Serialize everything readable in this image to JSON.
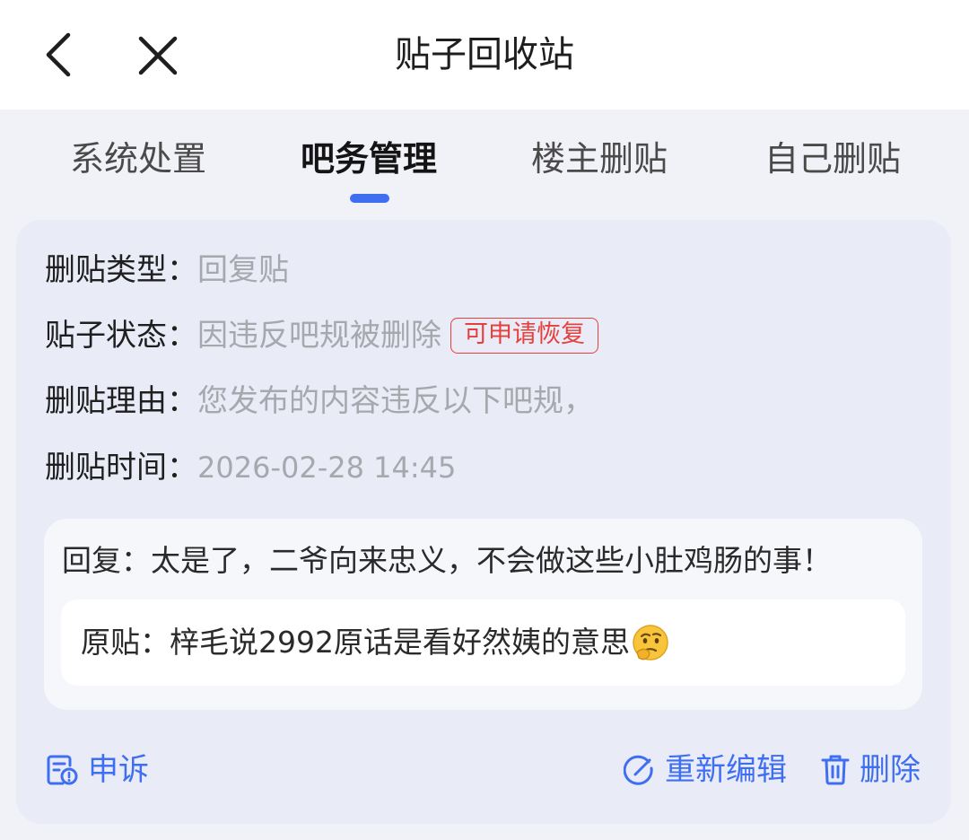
{
  "header": {
    "title": "贴子回收站"
  },
  "tabs": [
    {
      "label": "系统处置",
      "active": false
    },
    {
      "label": "吧务管理",
      "active": true
    },
    {
      "label": "楼主删贴",
      "active": false
    },
    {
      "label": "自己删贴",
      "active": false
    }
  ],
  "post": {
    "type_label": "删贴类型：",
    "type_value": "回复贴",
    "status_label": "贴子状态：",
    "status_value": "因违反吧规被删除",
    "status_badge": "可申请恢复",
    "reason_label": "删贴理由：",
    "reason_value": "您发布的内容违反以下吧规，",
    "time_label": "删贴时间：",
    "time_value": "2026-02-28 14:45",
    "reply_text": "回复：太是了，二爷向来忠义，不会做这些小肚鸡肠的事！",
    "origin_text": "原贴：梓毛说2992原话是看好然姨的意思"
  },
  "actions": {
    "appeal": "申诉",
    "reedit": "重新编辑",
    "delete": "删除"
  },
  "colors": {
    "accent": "#3f6ff1",
    "danger": "#e5403c",
    "card_bg": "#e9ebf7",
    "muted_text": "#a7a8ae"
  },
  "icons": {
    "back": "chevron-left-icon",
    "close": "close-icon",
    "appeal": "appeal-document-icon",
    "reedit": "edit-icon",
    "delete": "trash-icon",
    "emoji": "thinking-face-emoji"
  }
}
